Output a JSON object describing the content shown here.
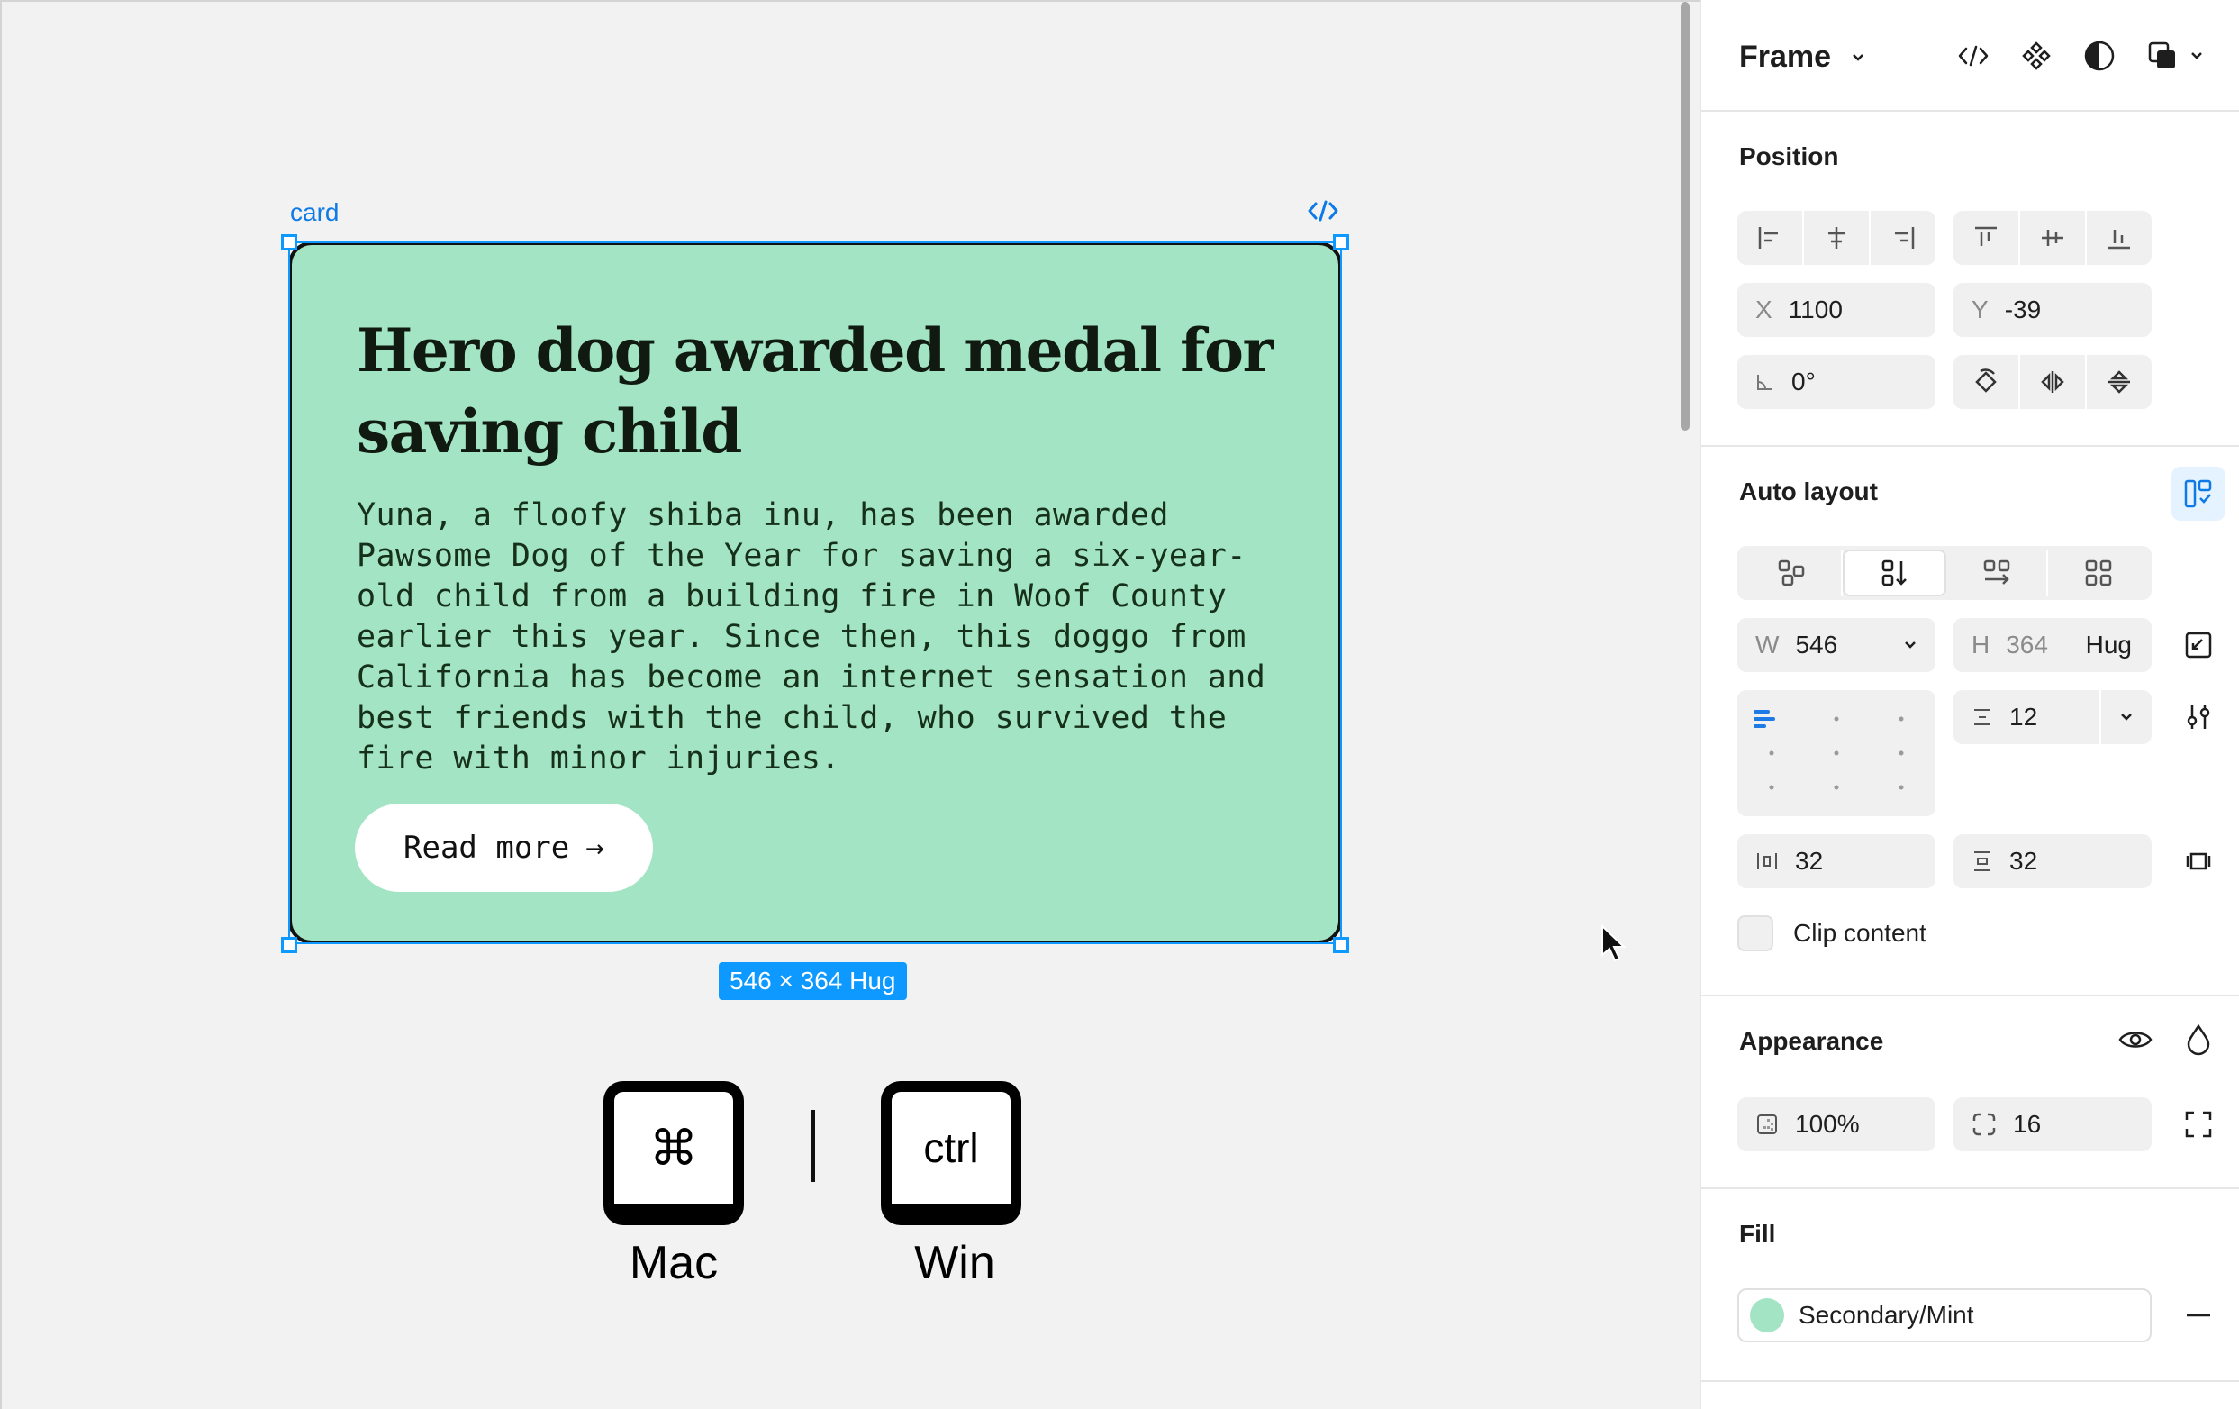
{
  "canvas": {
    "frame_label": "card",
    "card": {
      "title": "Hero dog awarded medal for saving child",
      "body": "Yuna, a floofy shiba inu, has been awarded Pawsome Dog of the Year for saving a six-year-old child from a building fire in Woof County earlier this year. Since then, this doggo from California has become an internet sensation and best friends with the child, who survived the fire with minor injuries.",
      "button_label": "Read more",
      "button_arrow": "→"
    },
    "dimension_badge": "546 × 364 Hug",
    "keys": {
      "mac_symbol": "⌘",
      "mac_label": "Mac",
      "win_symbol": "ctrl",
      "win_label": "Win"
    }
  },
  "panel": {
    "header": {
      "title": "Frame"
    },
    "position": {
      "title": "Position",
      "x_prefix": "X",
      "x": "1100",
      "y_prefix": "Y",
      "y": "-39",
      "rotation": "0°"
    },
    "auto_layout": {
      "title": "Auto layout",
      "w_prefix": "W",
      "width": "546",
      "h_prefix": "H",
      "height": "364",
      "height_mode": "Hug",
      "gap": "12",
      "padding_horizontal": "32",
      "padding_vertical": "32",
      "clip_content_label": "Clip content"
    },
    "appearance": {
      "title": "Appearance",
      "opacity": "100%",
      "radius": "16"
    },
    "fill": {
      "title": "Fill",
      "style_name": "Secondary/Mint",
      "swatch_color": "#a2e4c4"
    }
  }
}
